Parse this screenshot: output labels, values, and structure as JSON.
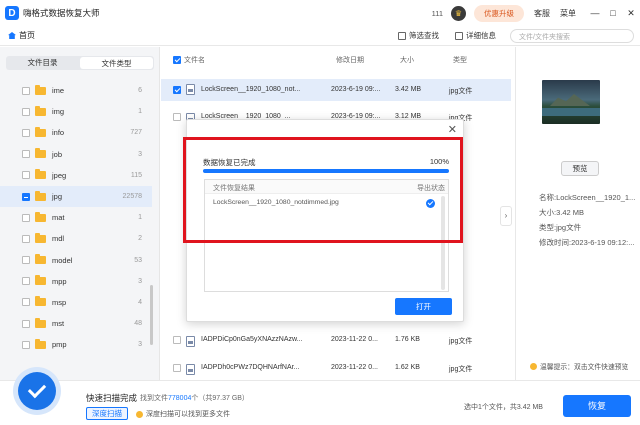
{
  "app": {
    "title": "嗨格式数据恢复大师",
    "count": "111",
    "upgrade": "优惠升级",
    "service": "客服",
    "menu": "菜单",
    "minimize": "—",
    "maximize": "□",
    "close": "✕"
  },
  "nav": {
    "home": "首页",
    "filter": "筛选查找",
    "details": "详细信息",
    "search_placeholder": "文件/文件夹搜索"
  },
  "sidebar": {
    "tabs": [
      "文件目录",
      "文件类型"
    ],
    "active_tab": 1,
    "items": [
      {
        "name": "ime",
        "count": "6"
      },
      {
        "name": "img",
        "count": "1"
      },
      {
        "name": "info",
        "count": "727"
      },
      {
        "name": "job",
        "count": "3"
      },
      {
        "name": "jpeg",
        "count": "115"
      },
      {
        "name": "jpg",
        "count": "22578",
        "selected": true
      },
      {
        "name": "mat",
        "count": "1"
      },
      {
        "name": "mdl",
        "count": "2"
      },
      {
        "name": "model",
        "count": "53"
      },
      {
        "name": "mpp",
        "count": "3"
      },
      {
        "name": "msp",
        "count": "4"
      },
      {
        "name": "mst",
        "count": "48"
      },
      {
        "name": "pmp",
        "count": "3"
      }
    ]
  },
  "filelist": {
    "headers": {
      "name": "文件名",
      "date": "修改日期",
      "size": "大小",
      "type": "类型"
    },
    "rows": [
      {
        "name": "LockScreen__1920_1080_not...",
        "date": "2023-6-19 09:...",
        "size": "3.42 MB",
        "type": "jpg文件",
        "selected": true
      },
      {
        "name": "LockScreen__1920_1080_...",
        "date": "2023-6-19 09:...",
        "size": "3.12 MB",
        "type": "jpg文件"
      },
      {
        "name": "IADPDiCp0nGa5yXNAzzNAzw...",
        "date": "2023-11-22 0...",
        "size": "1.76 KB",
        "type": "jpg文件"
      },
      {
        "name": "IADPDh0cPWz7DQHNArfNAr...",
        "date": "2023-11-22 0...",
        "size": "1.62 KB",
        "type": "jpg文件"
      }
    ]
  },
  "preview": {
    "button": "预览",
    "name": "名称:LockScreen__1920_1...",
    "size": "大小:3.42 MB",
    "type": "类型:jpg文件",
    "modified": "修改时间:2023-6-19 09:12:...",
    "tip": "温馨提示：双击文件快速预览"
  },
  "bottom": {
    "title": "快速扫描完成",
    "found_prefix": "找到文件",
    "found_count": "778004",
    "found_suffix": "个（共97.37 GB）",
    "deep_button": "深度扫描",
    "deep_tip": "深度扫描可以找到更多文件",
    "selected_info": "选中1个文件，共3.42 MB",
    "recover_button": "恢复"
  },
  "dialog": {
    "title": "数据恢复已完成",
    "percent": "100%",
    "progress": 1.0,
    "header_result": "文件恢复结果",
    "header_status": "导出状态",
    "result_file": "LockScreen__1920_1080_notdimmed.jpg",
    "open_button": "打开",
    "close": "✕"
  },
  "colors": {
    "accent": "#1677ff",
    "highlight": "#e0141e",
    "selection": "#e3ecfa"
  }
}
